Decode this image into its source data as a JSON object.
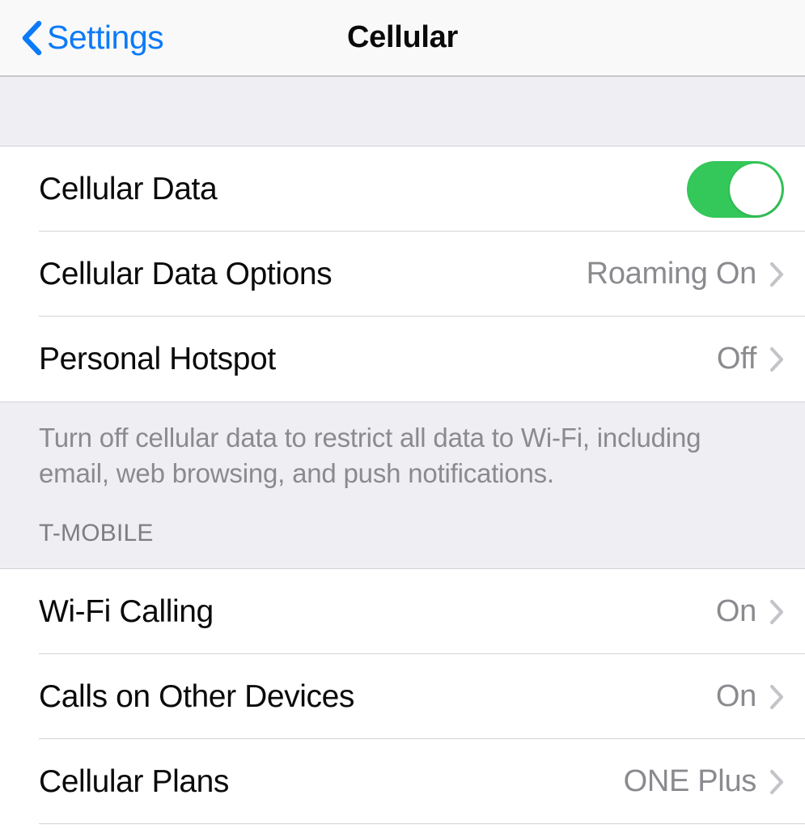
{
  "navbar": {
    "back_label": "Settings",
    "back_icon": "chevron-left-icon",
    "title": "Cellular",
    "accent_color": "#0b7bf7"
  },
  "colors": {
    "toggle_on": "#34c759",
    "value_text": "#8a8a8f",
    "group_background": "#efeef3",
    "row_background": "#ffffff",
    "separator": "#d4d3d8"
  },
  "sections": [
    {
      "name": "primary",
      "rows": [
        {
          "label": "Cellular Data",
          "control": "toggle",
          "toggle_state": "on",
          "value": "",
          "chevron": false
        },
        {
          "label": "Cellular Data Options",
          "control": "disclosure",
          "value": "Roaming On",
          "chevron": true,
          "chevron_icon": "chevron-right-icon"
        },
        {
          "label": "Personal Hotspot",
          "control": "disclosure",
          "value": "Off",
          "chevron": true,
          "chevron_icon": "chevron-right-icon"
        }
      ],
      "footer_text": "Turn off cellular data to restrict all data to Wi-Fi, including email, web browsing, and push notifications."
    },
    {
      "name": "carrier",
      "header": "T-MOBILE",
      "rows": [
        {
          "label": "Wi-Fi Calling",
          "control": "disclosure",
          "value": "On",
          "chevron": true,
          "chevron_icon": "chevron-right-icon"
        },
        {
          "label": "Calls on Other Devices",
          "control": "disclosure",
          "value": "On",
          "chevron": true,
          "chevron_icon": "chevron-right-icon"
        },
        {
          "label": "Cellular Plans",
          "control": "disclosure",
          "value": "ONE Plus",
          "chevron": true,
          "chevron_icon": "chevron-right-icon"
        }
      ]
    }
  ]
}
